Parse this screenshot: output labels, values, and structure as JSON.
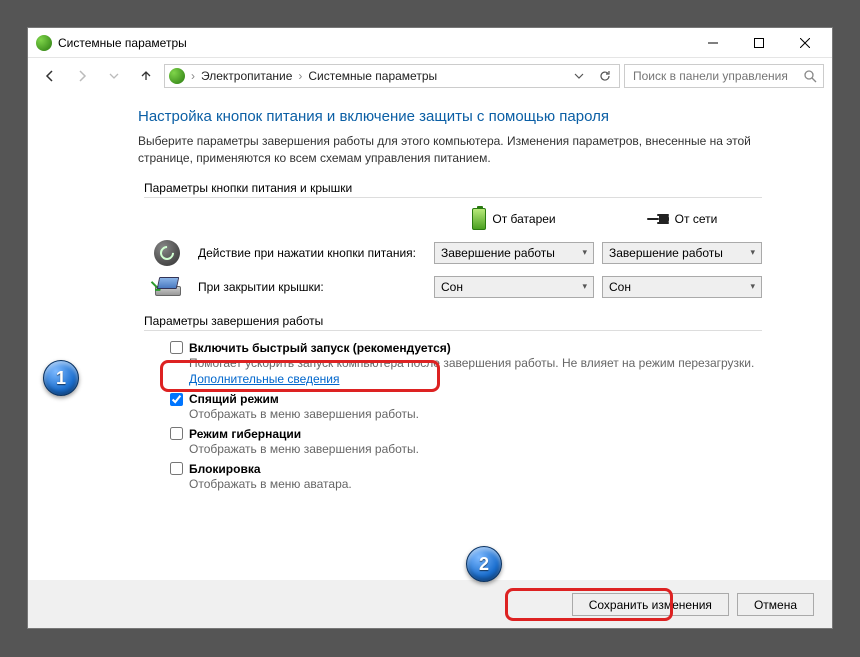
{
  "window": {
    "title": "Системные параметры"
  },
  "breadcrumb": {
    "root": "Электропитание",
    "current": "Системные параметры"
  },
  "search": {
    "placeholder": "Поиск в панели управления"
  },
  "page": {
    "title": "Настройка кнопок питания и включение защиты с помощью пароля",
    "description": "Выберите параметры завершения работы для этого компьютера. Изменения параметров, внесенные на этой странице, применяются ко всем схемам управления питанием."
  },
  "sections": {
    "buttons_and_lid": "Параметры кнопки питания и крышки",
    "shutdown": "Параметры завершения работы"
  },
  "columns": {
    "on_battery": "От батареи",
    "plugged_in": "От сети"
  },
  "rows": {
    "power_button": "Действие при нажатии кнопки питания:",
    "lid_close": "При закрытии крышки:"
  },
  "dropdown_values": {
    "power_battery": "Завершение работы",
    "power_plugged": "Завершение работы",
    "lid_battery": "Сон",
    "lid_plugged": "Сон"
  },
  "options": {
    "fast_startup": {
      "label": "Включить быстрый запуск (рекомендуется)",
      "desc_1": "Помогает ускорить запуск компьютера после завершения работы. Не влияет на режим перезагрузки.",
      "link": "Дополнительные сведения",
      "checked": false
    },
    "sleep": {
      "label": "Спящий режим",
      "desc": "Отображать в меню завершения работы.",
      "checked": true
    },
    "hibernate": {
      "label": "Режим гибернации",
      "desc": "Отображать в меню завершения работы.",
      "checked": false
    },
    "lock": {
      "label": "Блокировка",
      "desc": "Отображать в меню аватара.",
      "checked": false
    }
  },
  "buttons": {
    "save": "Сохранить изменения",
    "cancel": "Отмена"
  },
  "annotations": {
    "badge1": "1",
    "badge2": "2"
  }
}
